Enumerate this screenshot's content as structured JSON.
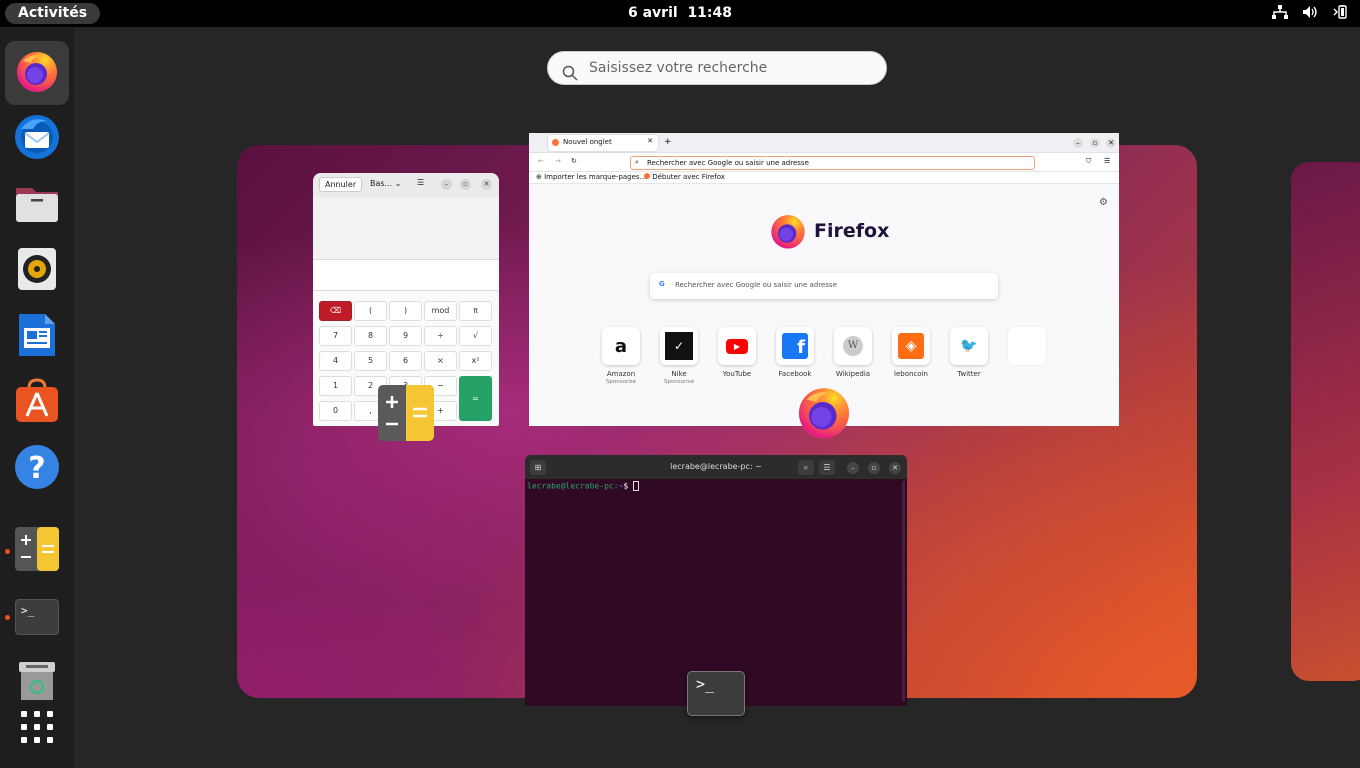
{
  "topbar": {
    "activities_label": "Activités",
    "date": "6 avril",
    "time": "11:48",
    "tray_icons": [
      "network-icon",
      "volume-icon",
      "battery-icon"
    ]
  },
  "search": {
    "placeholder": "Saisissez votre recherche"
  },
  "dock": {
    "apps": [
      {
        "name": "Firefox",
        "icon": "firefox-icon",
        "running": true,
        "active": true
      },
      {
        "name": "Thunderbird",
        "icon": "thunderbird-icon",
        "running": false
      },
      {
        "name": "Fichiers",
        "icon": "files-icon",
        "running": false
      },
      {
        "name": "Rhythmbox",
        "icon": "rhythmbox-icon",
        "running": false
      },
      {
        "name": "LibreOffice Writer",
        "icon": "writer-icon",
        "running": false
      },
      {
        "name": "Ubuntu Software",
        "icon": "software-icon",
        "running": false
      },
      {
        "name": "Aide",
        "icon": "help-icon",
        "running": false
      },
      {
        "name": "Calculatrice",
        "icon": "calculator-icon",
        "running": true
      },
      {
        "name": "Terminal",
        "icon": "terminal-icon",
        "running": true
      },
      {
        "name": "Corbeille",
        "icon": "trash-icon",
        "running": false
      },
      {
        "name": "Afficher les applications",
        "icon": "app-grid-icon",
        "running": false
      }
    ],
    "help_glyph": "?",
    "terminal_glyph": ">_"
  },
  "calculator": {
    "cancel_label": "Annuler",
    "mode_label": "Bas...",
    "keys": {
      "backspace": "⌫",
      "lparen": "(",
      "rparen": ")",
      "mod": "mod",
      "pi": "π",
      "k7": "7",
      "k8": "8",
      "k9": "9",
      "div": "÷",
      "sqrt": "√",
      "k4": "4",
      "k5": "5",
      "k6": "6",
      "mul": "×",
      "sq": "x²",
      "k1": "1",
      "k2": "2",
      "k3": "3",
      "minus": "−",
      "k0": "0",
      "dot": ",",
      "plus": "+",
      "equals": "="
    }
  },
  "firefox": {
    "tab_label": "Nouvel onglet",
    "new_tab": "+",
    "urlbar_placeholder": "Rechercher avec Google ou saisir une adresse",
    "bookmarks": [
      "Importer les marque-pages…",
      "Débuter avec Firefox"
    ],
    "brand": "Firefox",
    "search_placeholder": "Rechercher avec Google ou saisir une adresse",
    "tiles": [
      {
        "label": "Amazon",
        "sub": "Sponsorisé",
        "glyph": "a"
      },
      {
        "label": "Nike",
        "sub": "Sponsorisé",
        "glyph": "✓"
      },
      {
        "label": "YouTube",
        "sub": "",
        "glyph": "▶"
      },
      {
        "label": "Facebook",
        "sub": "",
        "glyph": "f"
      },
      {
        "label": "Wikipedia",
        "sub": "",
        "glyph": "W"
      },
      {
        "label": "leboncoin",
        "sub": "",
        "glyph": "◈"
      },
      {
        "label": "Twitter",
        "sub": "",
        "glyph": "🐦"
      },
      {
        "label": "",
        "sub": "",
        "glyph": ""
      }
    ]
  },
  "terminal": {
    "title": "lecrabe@lecrabe-pc: ~",
    "prompt_user": "lecrabe@lecrabe-pc",
    "prompt_path": ":~",
    "prompt_symbol": "$"
  },
  "overlay_icons": {
    "terminal_glyph": ">_"
  },
  "colors": {
    "ubuntu_orange": "#e95420",
    "calc_equals_green": "#26a269",
    "calc_backspace_red": "#c01c28",
    "terminal_bg": "#300a24",
    "prompt_green": "#26a269",
    "prompt_blue": "#12488b"
  }
}
